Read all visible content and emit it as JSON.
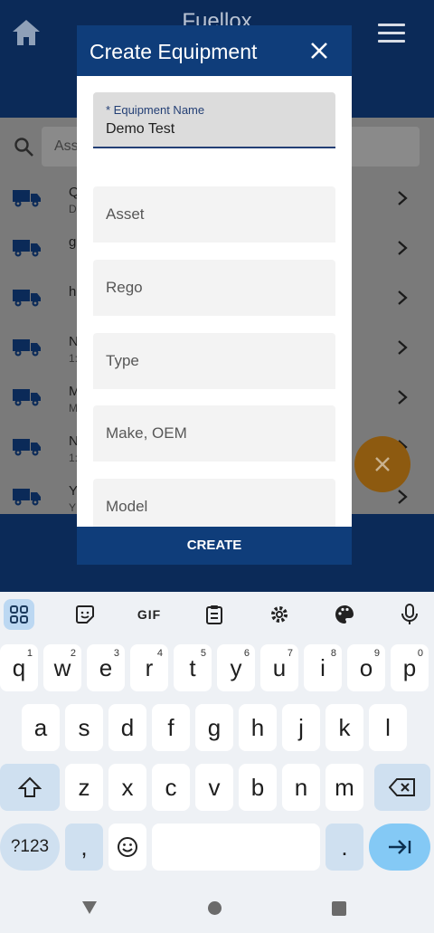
{
  "app": {
    "title": "Fuellox",
    "search_placeholder": "Asset",
    "items": [
      {
        "name": "Q",
        "sub": "D"
      },
      {
        "name": "g",
        "sub": ""
      },
      {
        "name": "h",
        "sub": ""
      },
      {
        "name": "N",
        "sub": "1:"
      },
      {
        "name": "M",
        "sub": "M"
      },
      {
        "name": "N",
        "sub": "1:"
      },
      {
        "name": "Y",
        "sub": "Y"
      }
    ]
  },
  "modal": {
    "title": "Create Equipment",
    "fields": [
      {
        "label": "* Equipment Name",
        "value": "Demo Test"
      },
      {
        "placeholder": "Asset"
      },
      {
        "placeholder": "Rego"
      },
      {
        "placeholder": "Type"
      },
      {
        "placeholder": "Make, OEM"
      },
      {
        "placeholder": "Model"
      }
    ],
    "create_label": "CREATE"
  },
  "keyboard": {
    "toolbar": [
      "apps-icon",
      "sticker-icon",
      "GIF",
      "clipboard-icon",
      "settings-icon",
      "palette-icon",
      "mic-icon"
    ],
    "row1": [
      {
        "k": "q",
        "n": "1"
      },
      {
        "k": "w",
        "n": "2"
      },
      {
        "k": "e",
        "n": "3"
      },
      {
        "k": "r",
        "n": "4"
      },
      {
        "k": "t",
        "n": "5"
      },
      {
        "k": "y",
        "n": "6"
      },
      {
        "k": "u",
        "n": "7"
      },
      {
        "k": "i",
        "n": "8"
      },
      {
        "k": "o",
        "n": "9"
      },
      {
        "k": "p",
        "n": "0"
      }
    ],
    "row2": [
      "a",
      "s",
      "d",
      "f",
      "g",
      "h",
      "j",
      "k",
      "l"
    ],
    "row3": [
      "z",
      "x",
      "c",
      "v",
      "b",
      "n",
      "m"
    ],
    "symbols_label": "?123",
    "comma_label": ",",
    "period_label": "."
  },
  "colors": {
    "header": "#0b2a58",
    "modal_header": "#0f3d7a",
    "accent": "#233f75",
    "fab": "#8d5a10"
  }
}
